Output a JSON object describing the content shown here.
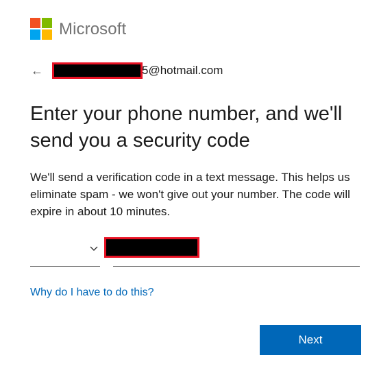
{
  "brand": {
    "name": "Microsoft",
    "logo_colors": [
      "#f25022",
      "#7fba00",
      "#00a4ef",
      "#ffb900"
    ]
  },
  "identity": {
    "back_icon": "arrow-left-icon",
    "email_suffix": "5@hotmail.com",
    "email_redacted": true
  },
  "title": "Enter your phone number, and we'll send you a security code",
  "description": "We'll send a verification code in a text message. This helps us eliminate spam - we won't give out your number. The code will expire in about 10 minutes.",
  "form": {
    "country_code_value": "",
    "country_icon": "chevron-down-icon",
    "phone_value_redacted": true
  },
  "links": {
    "why": "Why do I have to do this?"
  },
  "buttons": {
    "next": "Next"
  },
  "colors": {
    "accent": "#0067b8",
    "redaction_border": "#e81123"
  }
}
